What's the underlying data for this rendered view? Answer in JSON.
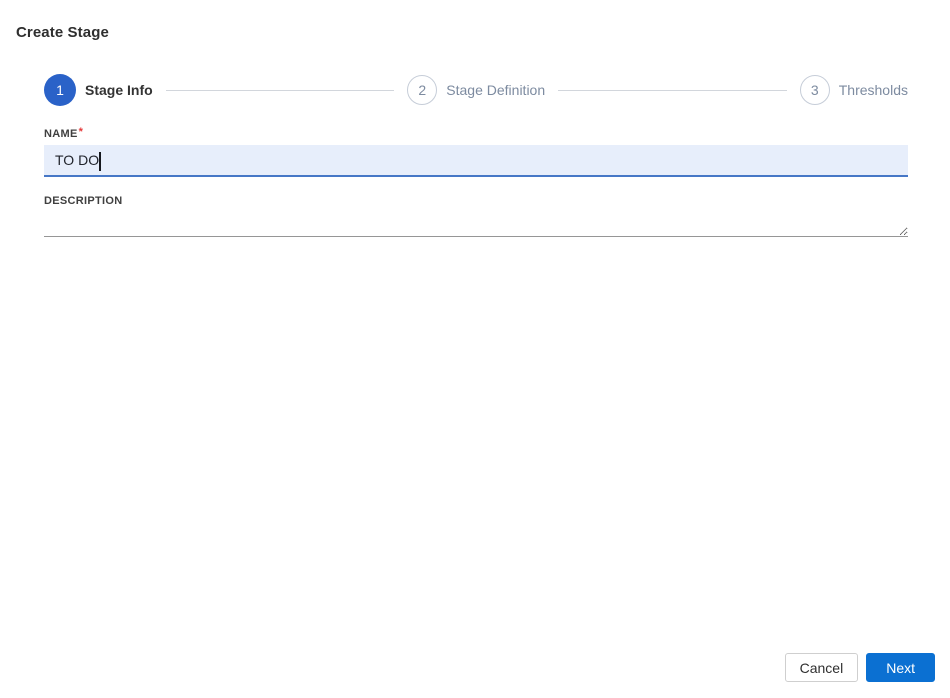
{
  "page": {
    "title": "Create Stage"
  },
  "stepper": {
    "steps": [
      {
        "number": "1",
        "label": "Stage Info",
        "state": "active"
      },
      {
        "number": "2",
        "label": "Stage Definition",
        "state": "inactive"
      },
      {
        "number": "3",
        "label": "Thresholds",
        "state": "inactive"
      }
    ]
  },
  "form": {
    "name": {
      "label": "NAME",
      "required_marker": "*",
      "value": "TO DO",
      "placeholder": ""
    },
    "description": {
      "label": "DESCRIPTION",
      "value": "",
      "placeholder": ""
    }
  },
  "footer": {
    "cancel_label": "Cancel",
    "next_label": "Next"
  },
  "colors": {
    "step_active_blue": "#2a62c8",
    "next_button_blue": "#0b70d2",
    "input_focus_bg": "#e7eefb",
    "input_focus_border": "#4677c6",
    "required_red": "#e5393a",
    "inactive_gray": "#7d8ba0",
    "connector_gray": "#d2d6dc"
  }
}
